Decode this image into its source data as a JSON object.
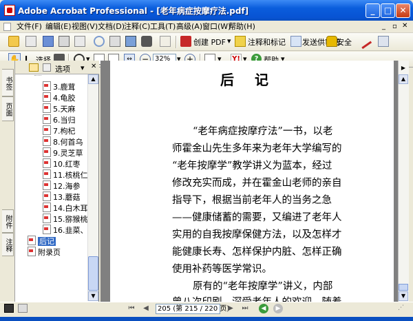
{
  "window": {
    "title": "Adobe Acrobat Professional - [老年病症按摩疗法.pdf]"
  },
  "menu": [
    "文件(F)",
    "编辑(E)",
    "视图(V)",
    "文档(D)",
    "注释(C)",
    "工具(T)",
    "高级(A)",
    "窗口(W)",
    "帮助(H)"
  ],
  "toolbar": {
    "create_pdf": "创建 PDF",
    "comment": "注释和标记",
    "review": "发送供审阅",
    "security": "安全",
    "select": "选择",
    "zoom": "32%",
    "help": "帮助"
  },
  "side_tabs": [
    "书签",
    "页面",
    "附件",
    "注释"
  ],
  "bookmarks": {
    "options": "选项",
    "items": [
      "3.鹿茸",
      "4.龟胶",
      "5.天麻",
      "6.当归",
      "7.枸杞",
      "8.何首乌",
      "9.灵芝草",
      "10.红枣",
      "11.核桃仁",
      "12.海参",
      "13.蘑菇",
      "14.白木耳",
      "15.猕猴桃",
      "16.韭菜、"
    ],
    "selected": "后记",
    "appendix": "附录页"
  },
  "document": {
    "heading": "后记",
    "lines": [
      "“老年病症按摩疗法”一书，以老",
      "师霍金山先生多年来为老年大学编写的",
      "“老年按摩学”教学讲义为蓝本，经过",
      "修改充实而成，并在霍金山老师的亲自",
      "指导下，根据当前老年人的当务之急",
      "——健康储蓄的需要，又编进了老年人",
      "实用的自我按摩保健方法，以及怎样才",
      "能健康长寿、怎样保护内脏、怎样正确",
      "使用补药等医学常识。",
      "原有的“老年按摩学”讲义，内部",
      "曾八次印刷，深受老年人的欢迎。随着"
    ]
  },
  "status": {
    "page_indicator": "205 (第 215 / 220 页)"
  }
}
